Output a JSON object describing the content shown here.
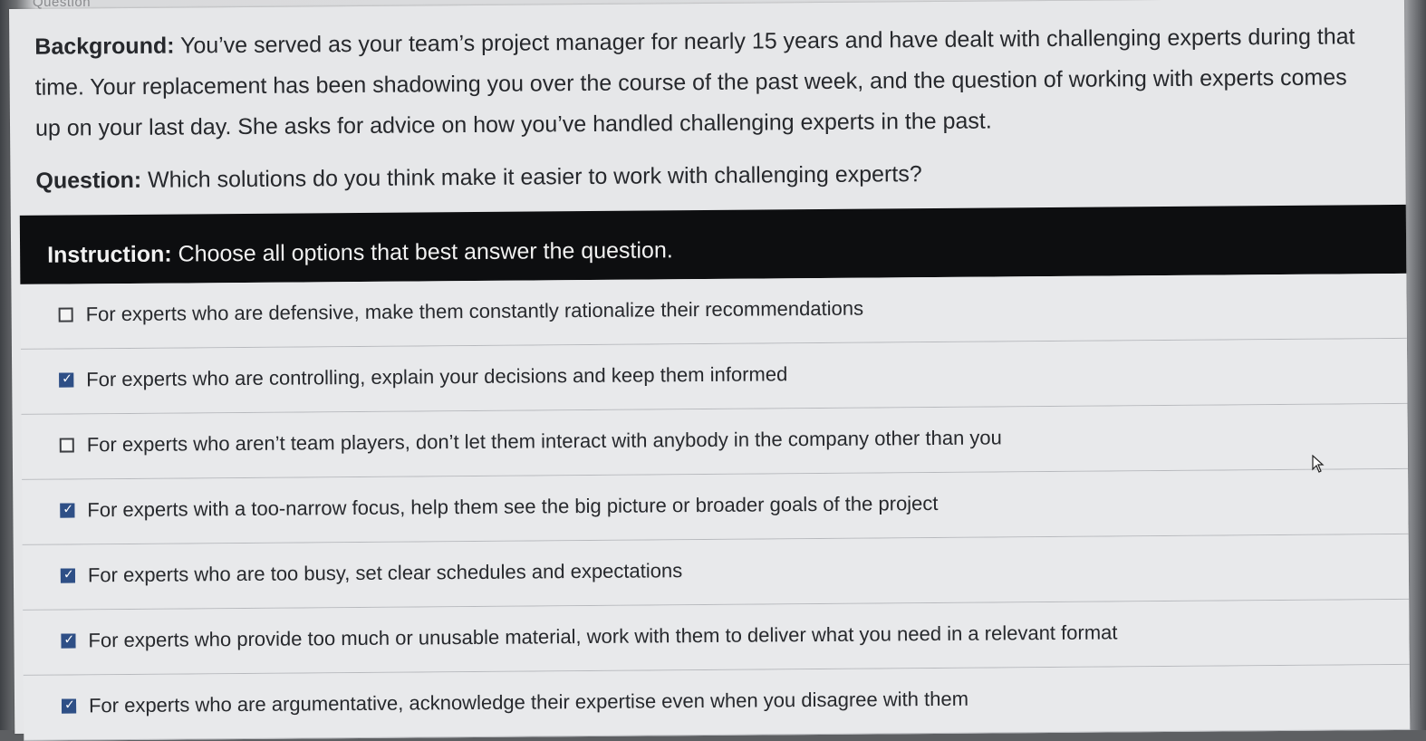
{
  "header": {
    "faded_label": "Question"
  },
  "background": {
    "label": "Background:",
    "text": " You’ve served as your team’s project manager for nearly 15 years and have dealt with challenging experts during that time. Your replacement has been shadowing you over the course of the past week, and the question of working with experts comes up on your last day. She asks for advice on how you’ve handled challenging experts in the past."
  },
  "question": {
    "label": "Question:",
    "text": " Which solutions do you think make it easier to work with challenging experts?"
  },
  "instruction": {
    "label": "Instruction:",
    "text": " Choose all options that best answer the question."
  },
  "options": [
    {
      "text": "For experts who are defensive, make them constantly rationalize their recommendations",
      "checked": false
    },
    {
      "text": "For experts who are controlling, explain your decisions and keep them informed",
      "checked": true
    },
    {
      "text": "For experts who aren’t team players, don’t let them interact with anybody in the company other than you",
      "checked": false
    },
    {
      "text": "For experts with a too-narrow focus, help them see the big picture or broader goals of the project",
      "checked": true
    },
    {
      "text": "For experts who are too busy, set clear schedules and expectations",
      "checked": true
    },
    {
      "text": "For experts who provide too much or unusable material, work with them to deliver what you need in a relevant format",
      "checked": true
    },
    {
      "text": "For experts who are argumentative, acknowledge their expertise even when you disagree with them",
      "checked": true
    }
  ],
  "colors": {
    "instruction_bar": "#0d0e10",
    "checkbox_checked": "#2e4f86",
    "page_background": "#e6e7e9"
  },
  "icons": {
    "cursor": "mouse-pointer-icon"
  }
}
